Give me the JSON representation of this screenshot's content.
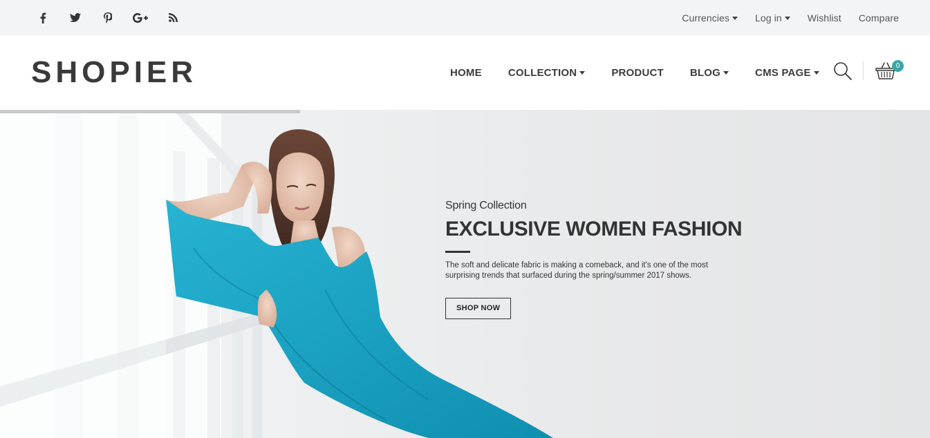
{
  "topbar": {
    "social_icons": [
      "facebook-icon",
      "twitter-icon",
      "pinterest-icon",
      "google-plus-icon",
      "rss-icon"
    ],
    "links": [
      {
        "label": "Currencies",
        "dropdown": true
      },
      {
        "label": "Log in",
        "dropdown": true
      },
      {
        "label": "Wishlist",
        "dropdown": false
      },
      {
        "label": "Compare",
        "dropdown": false
      }
    ]
  },
  "header": {
    "logo": "SHOPIER",
    "nav": [
      {
        "label": "HOME",
        "dropdown": false
      },
      {
        "label": "COLLECTION",
        "dropdown": true
      },
      {
        "label": "PRODUCT",
        "dropdown": false
      },
      {
        "label": "BLOG",
        "dropdown": true
      },
      {
        "label": "CMS PAGE",
        "dropdown": true
      }
    ],
    "cart_count": "0",
    "search_icon": "search-icon",
    "cart_icon": "cart-basket-icon"
  },
  "hero": {
    "subtitle": "Spring Collection",
    "title": "EXCLUSIVE WOMEN FASHION",
    "description": "The soft and delicate fabric is making a comeback, and it's one of the most surprising trends that surfaced during the spring/summer 2017 shows.",
    "button": "SHOP NOW"
  },
  "colors": {
    "topbar_bg": "#f3f4f6",
    "accent": "#3aa6a8",
    "dress": "#1aa3c4",
    "text_dark": "#333333"
  }
}
